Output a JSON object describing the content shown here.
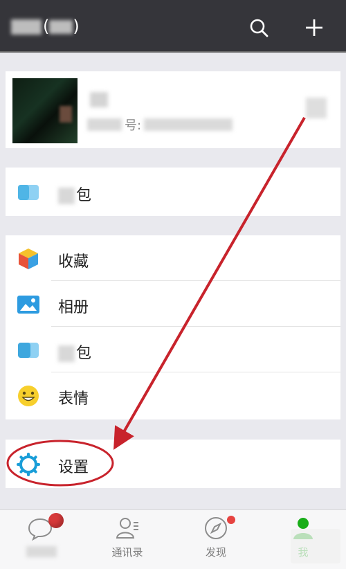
{
  "header": {
    "title_open": "(",
    "title_close": ")",
    "search_icon": "search-icon",
    "add_icon": "plus-icon"
  },
  "profile": {
    "id_label": "号:"
  },
  "wallet": {
    "label_suffix": "包"
  },
  "menu": {
    "favorites": "收藏",
    "album": "相册",
    "cards_suffix": "包",
    "stickers": "表情"
  },
  "settings": {
    "label": "设置"
  },
  "tabs": [
    {
      "label": "",
      "icon": "chat-bubble-icon"
    },
    {
      "label": "通讯录",
      "icon": "contacts-icon"
    },
    {
      "label": "发现",
      "icon": "compass-icon"
    },
    {
      "label": "我",
      "icon": "person-icon"
    }
  ],
  "colors": {
    "header_bg": "#35353a",
    "accent_green": "#19ad19",
    "badge_red": "#e64340",
    "annotation_red": "#c8232c",
    "settings_icon": "#1a9ed8"
  }
}
